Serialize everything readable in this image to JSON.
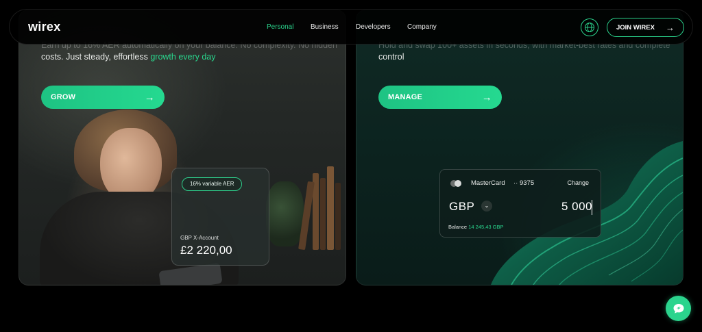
{
  "header": {
    "logo": "wirex",
    "nav": [
      {
        "label": "Personal",
        "active": true
      },
      {
        "label": "Business",
        "active": false
      },
      {
        "label": "Developers",
        "active": false
      },
      {
        "label": "Company",
        "active": false
      }
    ],
    "globe_icon": "globe-icon",
    "join_label": "JOIN WIREX",
    "join_arrow": "→"
  },
  "left_card": {
    "faded_line": "Earn up to 16% AER automatically on your balance. No complexity. No hidden",
    "copy_prefix": "costs. Just steady, effortless ",
    "copy_highlight": "growth every day",
    "cta_label": "GROW",
    "cta_arrow": "→",
    "account": {
      "badge": "16% variable AER",
      "label": "GBP X-Account",
      "amount": "£2 220,00"
    }
  },
  "right_card": {
    "faded_line": "Hold and swap 100+ assets in seconds, with market-best rates and complete",
    "copy": "control",
    "cta_label": "MANAGE",
    "cta_arrow": "→",
    "payment": {
      "card_name": "MasterCard",
      "card_number": "·· 9375",
      "change_label": "Change",
      "currency": "GBP",
      "dropdown_icon": "chevron-down-icon",
      "amount": "5 000",
      "balance_label": "Balance ",
      "balance_value": "14 245,43 GBP"
    }
  },
  "chat": {
    "icon": "chat-icon"
  },
  "colors": {
    "accent": "#2bd48d",
    "background": "#000000"
  }
}
